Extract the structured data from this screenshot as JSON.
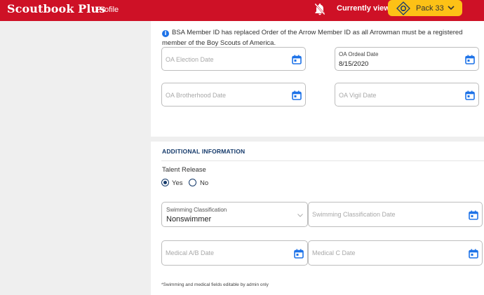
{
  "header": {
    "brand": "Scoutbook Plus",
    "nav_profile": "Profile",
    "viewing_label": "Currently viewing:",
    "unit_name": "Pack 33",
    "brand_color": "#ce1126",
    "accent_color": "#fdc116",
    "icons": {
      "notifications": "bell-off-icon",
      "unit": "cub-scout-logo-icon",
      "dropdown": "chevron-down-icon"
    }
  },
  "oa": {
    "notice": "BSA Member ID has replaced Order of the Arrow Member ID as all Arrowman must be a registered member of the Boy Scouts of America.",
    "election_placeholder": "OA Election Date",
    "ordeal_label": "OA Ordeal Date",
    "ordeal_value": "8/15/2020",
    "brotherhood_placeholder": "OA Brotherhood Date",
    "vigil_placeholder": "OA Vigil Date"
  },
  "additional": {
    "section_title": "ADDITIONAL INFORMATION",
    "talent_release_label": "Talent Release",
    "talent_release_options": [
      "Yes",
      "No"
    ],
    "talent_release_selected": "Yes",
    "swimming_label": "Swimming Classification",
    "swimming_value": "Nonswimmer",
    "swimming_date_placeholder": "Swimming Classification Date",
    "medical_ab_placeholder": "Medical A/B Date",
    "medical_c_placeholder": "Medical C Date",
    "footnote": "*Swimming and medical fields editable by admin only"
  },
  "colors": {
    "calendar_icon": "#1e73e8",
    "heading": "#153a6b"
  }
}
